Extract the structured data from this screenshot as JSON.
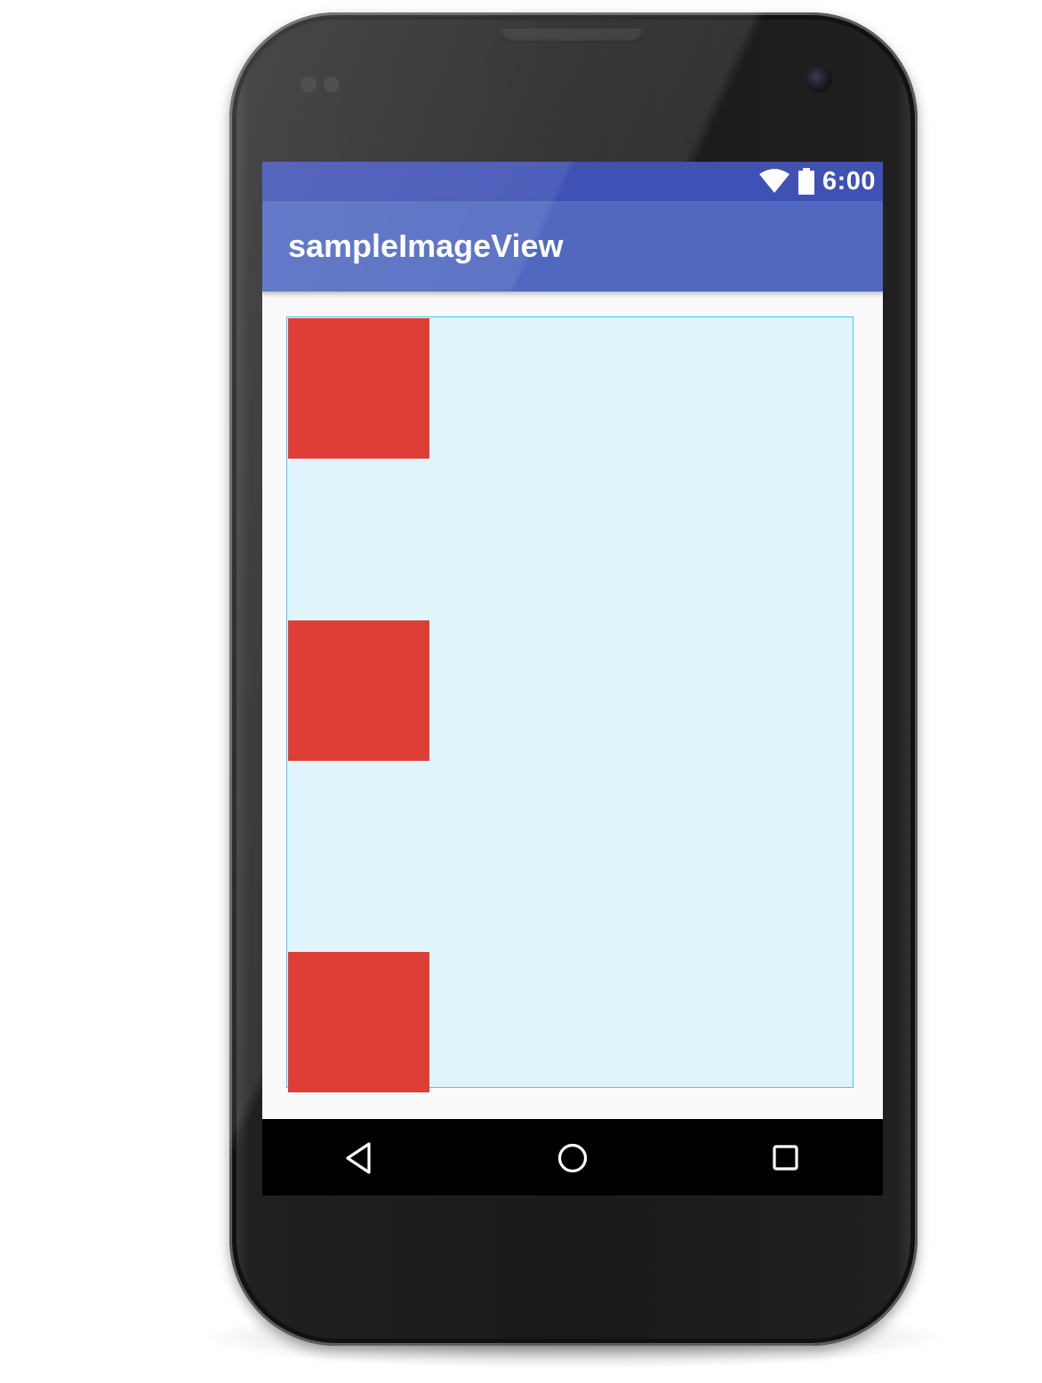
{
  "status_bar": {
    "time": "6:00",
    "icons": [
      "wifi-icon",
      "battery-icon"
    ]
  },
  "app_bar": {
    "title": "sampleImageView"
  },
  "content": {
    "image_count": 3,
    "square_color": "#df3e37",
    "container_background": "#e0f4fc",
    "container_border": "#4fc3f7"
  },
  "nav_bar": {
    "buttons": [
      "back-icon",
      "home-icon",
      "recents-icon"
    ]
  },
  "colors": {
    "status_bar": "#3f51b5",
    "app_bar": "#5068c0",
    "nav_bar": "#000000"
  }
}
